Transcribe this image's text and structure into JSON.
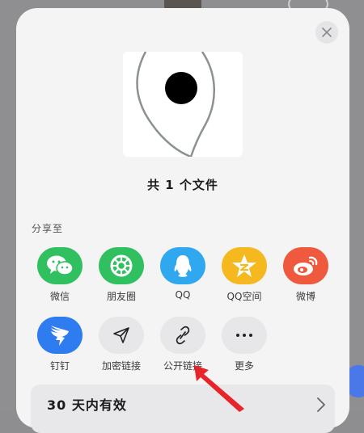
{
  "sheet": {
    "file_count": "共 1 个文件",
    "share_label": "分享至",
    "close_icon": "close-icon"
  },
  "share_apps": [
    {
      "label": "微信",
      "icon": "wechat-icon",
      "color": "#30c060"
    },
    {
      "label": "朋友圈",
      "icon": "moments-icon",
      "color": "#30c060"
    },
    {
      "label": "QQ",
      "icon": "qq-icon",
      "color": "#2fa8f0"
    },
    {
      "label": "QQ空间",
      "icon": "qzone-icon",
      "color": "#f5b81e"
    },
    {
      "label": "微博",
      "icon": "weibo-icon",
      "color": "#ef5a3e"
    }
  ],
  "link_actions": [
    {
      "label": "钉钉",
      "icon": "dingtalk-icon",
      "color": "#2e7cf0"
    },
    {
      "label": "加密链接",
      "icon": "send-icon"
    },
    {
      "label": "公开链接",
      "icon": "link-icon"
    },
    {
      "label": "更多",
      "icon": "more-icon"
    }
  ],
  "validity": {
    "label": "30 天内有效"
  },
  "colors": {
    "sheet_bg": "#f4f4f5",
    "annotation_arrow": "#e8232a"
  }
}
